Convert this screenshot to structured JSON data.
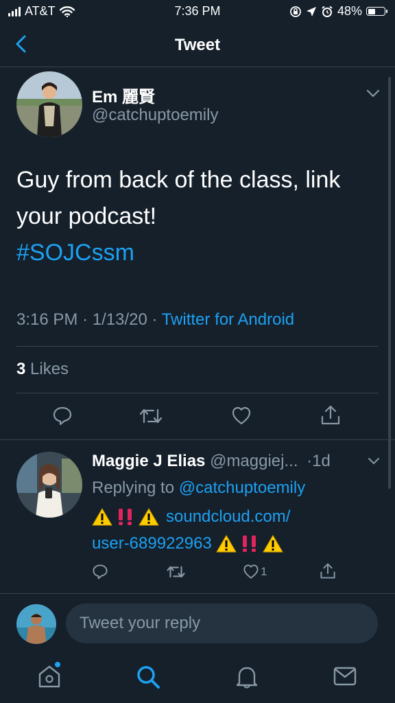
{
  "status_bar": {
    "carrier": "AT&T",
    "time": "7:36 PM",
    "battery": "48%",
    "battery_level": 0.48
  },
  "header": {
    "title": "Tweet",
    "back_icon": "chevron-left-icon"
  },
  "tweet": {
    "author_name": "Em 麗賢",
    "author_handle": "@catchuptoemily",
    "text_line1": "Guy from back of the class, link",
    "text_line2": "your podcast!",
    "hashtag": "#SOJCssm",
    "time": "3:16 PM",
    "date": "1/13/20",
    "source": "Twitter for Android",
    "sep": "·",
    "likes_count": "3",
    "likes_label": "Likes"
  },
  "reply": {
    "author_name": "Maggie J Elias",
    "author_handle": "@maggiej...",
    "age": "·1d",
    "replying_prefix": "Replying to",
    "replying_handle": "@catchuptoemily",
    "link_line1": "soundcloud.com/",
    "link_line2": "user-689922963",
    "like_count": "1"
  },
  "compose": {
    "placeholder": "Tweet your reply"
  },
  "colors": {
    "background": "#15202b",
    "accent": "#1da1f2",
    "muted": "#8899a6",
    "divider": "#38444d",
    "warning": "#ffcc00",
    "exclaim": "#e0245e"
  }
}
